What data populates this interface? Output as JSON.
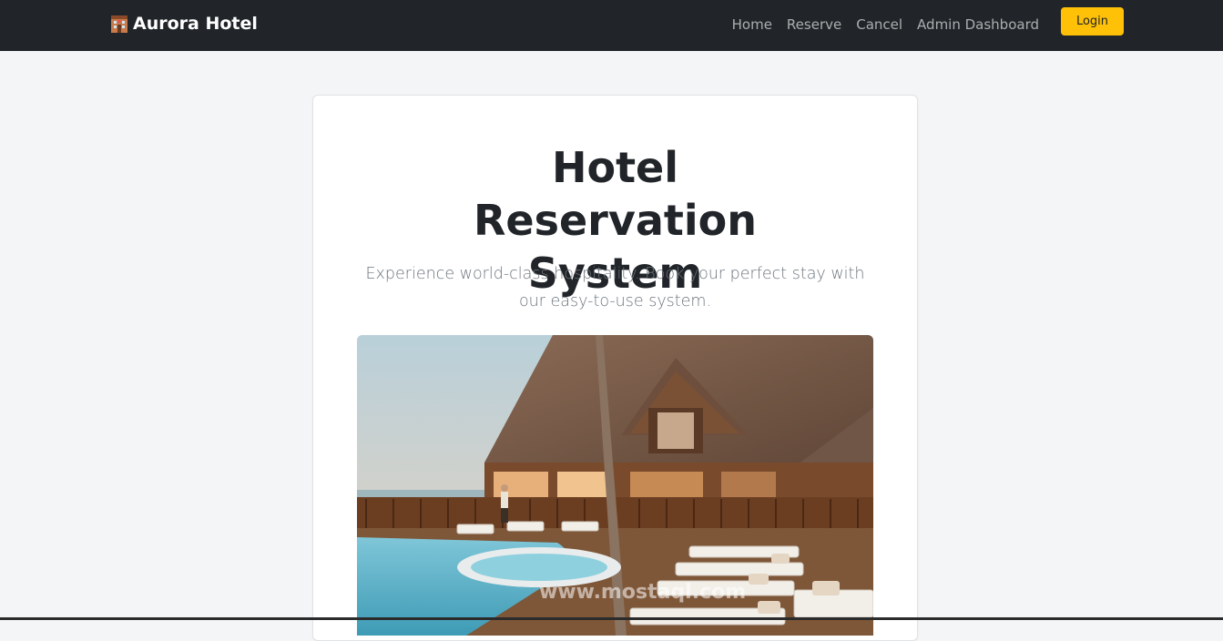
{
  "navbar": {
    "brand": "Aurora Hotel",
    "brand_icon": "hotel-icon",
    "links": [
      {
        "label": "Home"
      },
      {
        "label": "Reserve"
      },
      {
        "label": "Cancel"
      },
      {
        "label": "Admin Dashboard"
      }
    ],
    "login_label": "Login",
    "background": "#212529",
    "login_color": "#ffc107"
  },
  "hero": {
    "title": "Hotel Reservation System",
    "subtitle": "Experience world-class hospitality. Book your perfect stay with our easy-to-use system.",
    "image": "hotel-pool-resort-photo",
    "watermark": "www.mostaql.com"
  }
}
